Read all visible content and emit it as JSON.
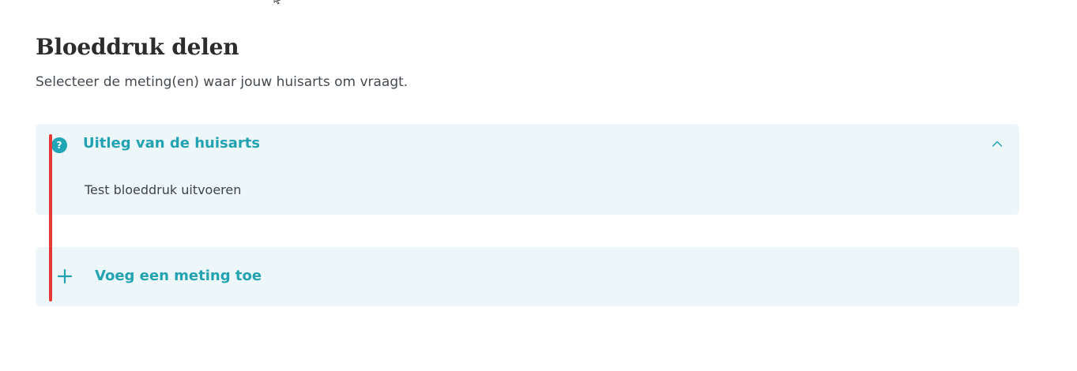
{
  "header": {
    "title": "Bloeddruk delen",
    "subtitle": "Selecteer de meting(en) waar jouw huisarts om vraagt."
  },
  "explanation": {
    "title": "Uitleg van de huisarts",
    "icon_glyph": "?",
    "icon": "question-icon",
    "toggle_icon": "chevron-up-icon",
    "body": "Test bloeddruk uitvoeren",
    "expanded": true
  },
  "add_measurement": {
    "label": "Voeg een meting toe",
    "icon": "plus-icon"
  },
  "colors": {
    "accent": "#23a3b2",
    "panel_background": "#edf6f9",
    "title_text": "#2c2c2c",
    "focus_marker": "#e53935"
  }
}
